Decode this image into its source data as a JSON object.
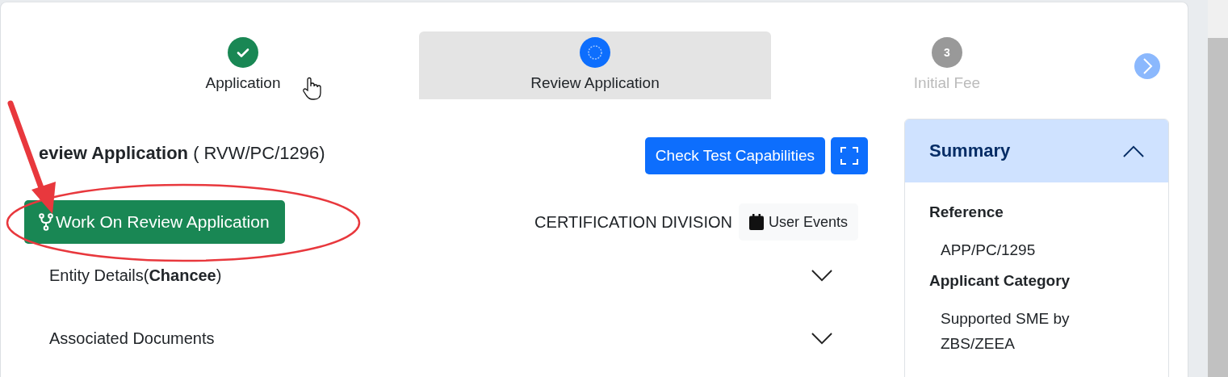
{
  "steps": [
    {
      "label": "Application",
      "done": true,
      "selected": false
    },
    {
      "label": "Review Application",
      "done": false,
      "selected": true
    },
    {
      "label": "Initial Fee",
      "done": false,
      "number": "3",
      "selected": false
    }
  ],
  "heading": {
    "title": "eview Application",
    "reference": "( RVW/PC/1296)"
  },
  "actions": [
    {
      "label": "Check Test Capabilities",
      "kind": "text"
    },
    {
      "kind": "fullscreen"
    }
  ],
  "work_button": "Work On Review Application",
  "division": "CERTIFICATION DIVISION",
  "events_button": "User Events",
  "sections": [
    {
      "title": "Entity Details(**Chancee**)",
      "expanded": false
    },
    {
      "title": "Associated Documents",
      "expanded": false
    }
  ],
  "summary": {
    "title": "Summary",
    "expanded": true,
    "fields": [
      {
        "label": "Reference",
        "value": "APP/PC/1295"
      },
      {
        "label": "Applicant Category",
        "value": "Supported SME by ZBS/ZEEA"
      }
    ]
  }
}
